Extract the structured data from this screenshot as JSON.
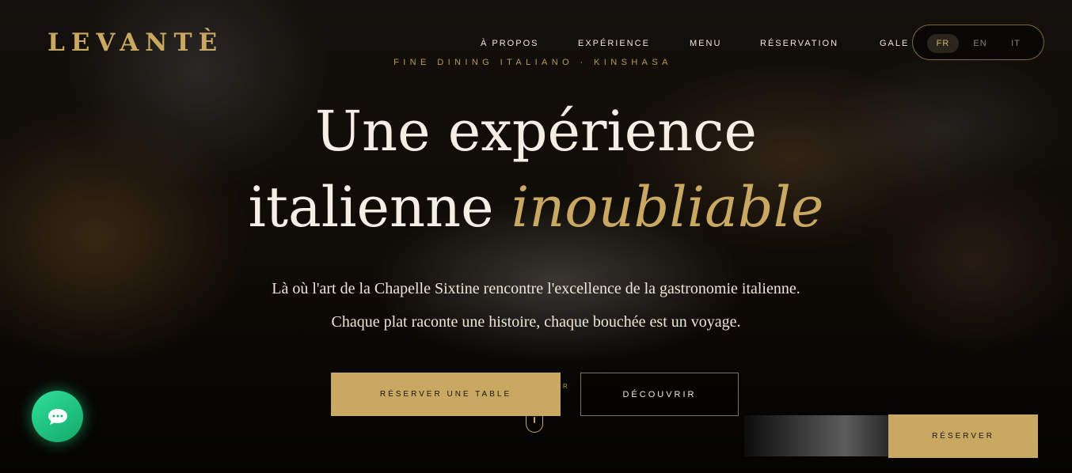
{
  "brand": {
    "logo": "LEVANTÈ"
  },
  "nav": {
    "items": [
      {
        "label": "À PROPOS"
      },
      {
        "label": "EXPÉRIENCE"
      },
      {
        "label": "MENU"
      },
      {
        "label": "RÉSERVATION"
      },
      {
        "label": "GALE"
      }
    ]
  },
  "language": {
    "options": [
      {
        "label": "FR"
      },
      {
        "label": "EN"
      },
      {
        "label": "IT"
      }
    ],
    "selected": "FR"
  },
  "hero": {
    "tagline": "FINE DINING ITALIANO · KINSHASA",
    "headline_line1": "Une expérience",
    "headline_line2": "italienne",
    "headline_accent": "inoubliable",
    "subtitle": "Là où l'art de la Chapelle Sixtine rencontre l'excellence de la gastronomie italienne. Chaque plat raconte une histoire, chaque bouchée est un voyage.",
    "primary_cta": "RÉSERVER UNE TABLE",
    "secondary_cta": "DÉCOUVRIR",
    "stray_char": "R"
  },
  "floating": {
    "reserve_cta": "RÉSERVER"
  },
  "colors": {
    "gold": "#c9a862",
    "chat_green": "#22c47f",
    "cream": "#f4eee4"
  },
  "icons": {
    "chat": "chat-bubble-icon",
    "scroll": "scroll-mouse-icon"
  }
}
